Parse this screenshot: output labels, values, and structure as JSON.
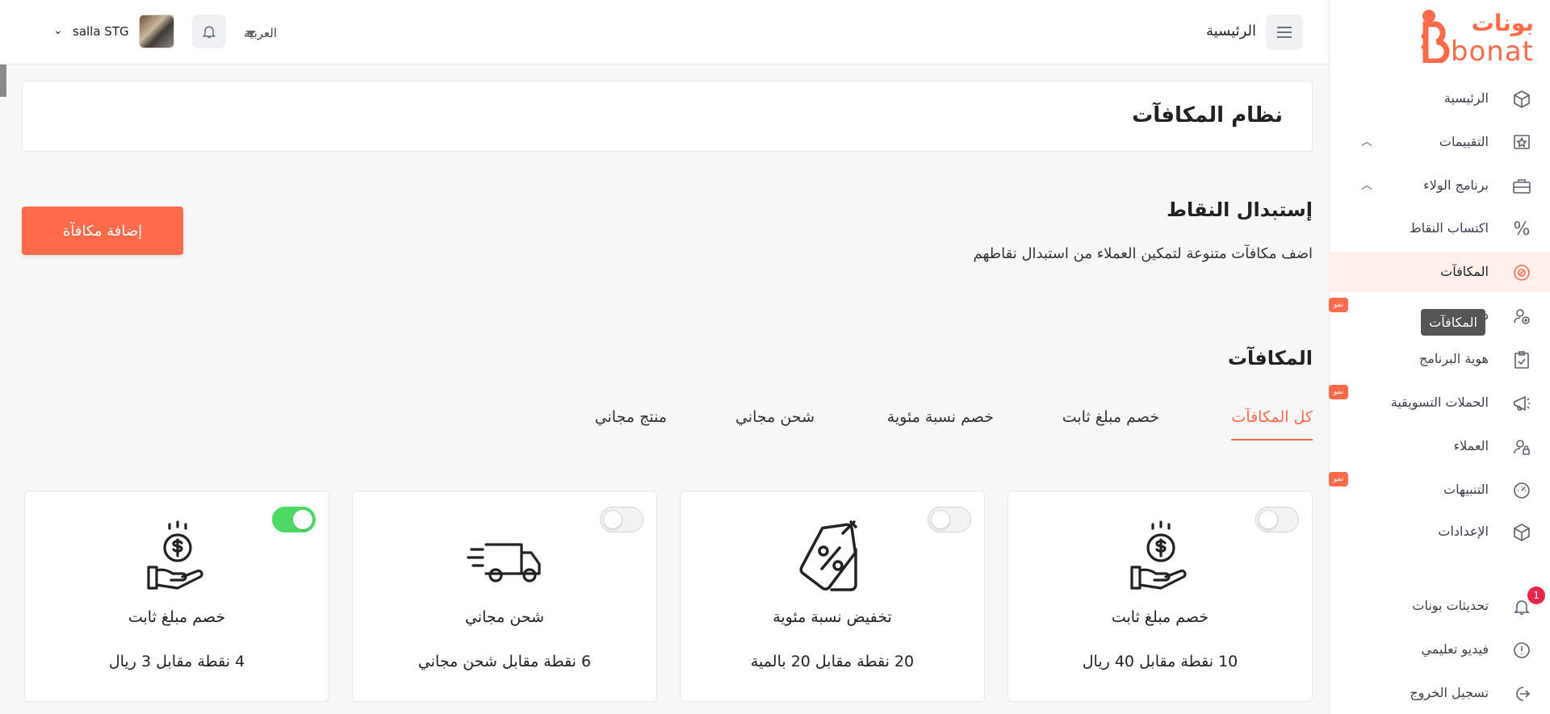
{
  "colors": {
    "accent": "#ff6b4a",
    "toggle_on": "#4cd964",
    "active_bg": "#fff0ec",
    "badge_red": "#e8264a"
  },
  "brand": {
    "name_ar": "بونات",
    "name_en": "bonat"
  },
  "sidebar": {
    "items": [
      {
        "label": "الرئيسية",
        "icon": "cube-icon"
      },
      {
        "label": "التقييمات",
        "icon": "star-badge-icon",
        "chevron": "up"
      },
      {
        "label": "برنامج الولاء",
        "icon": "briefcase-icon",
        "chevron": "up"
      },
      {
        "label": "اكتساب النقاط",
        "icon": "percent-icon"
      },
      {
        "label": "المكافآت",
        "icon": "coin-icon",
        "active": true
      },
      {
        "label": "دع",
        "icon": "user-plus-icon",
        "badge": "نمو"
      },
      {
        "label": "هوية البرنامج",
        "icon": "clipboard-check-icon"
      },
      {
        "label": "الحملات التسويقية",
        "icon": "megaphone-icon",
        "badge": "نمو"
      },
      {
        "label": "العملاء",
        "icon": "user-lock-icon"
      },
      {
        "label": "التنبيهات",
        "icon": "gauge-icon",
        "badge": "نمو"
      },
      {
        "label": "الإعدادات",
        "icon": "cube-icon"
      },
      {
        "label": "تحديثات بونات",
        "icon": "bell-icon",
        "count": "1"
      },
      {
        "label": "فيديو تعليمي",
        "icon": "info-circle-icon"
      },
      {
        "label": "تسجيل الخروج",
        "icon": "logout-icon"
      }
    ],
    "tooltip": "المكافآت"
  },
  "topbar": {
    "title": "الرئيسية",
    "language": "العربية",
    "store_name": "salla STG"
  },
  "page": {
    "title": "نظام المكافآت",
    "section_title": "إستبدال النقاط",
    "section_desc": "اضف مكافآت متنوعة لتمكين العملاء من استبدال نقاطهم",
    "add_button": "إضافة مكافآة",
    "rewards_title": "المكافآت"
  },
  "tabs": [
    {
      "label": "كل المكافآت",
      "active": true
    },
    {
      "label": "خصم مبلغ ثابت"
    },
    {
      "label": "خصم نسبة مئوية"
    },
    {
      "label": "شحن مجاني"
    },
    {
      "label": "منتج مجاني"
    }
  ],
  "cards": [
    {
      "name": "خصم مبلغ ثابت",
      "value": "10 نقطة مقابل 40 ريال",
      "icon": "hand-coin-icon",
      "enabled": false
    },
    {
      "name": "تخفيض نسبة مئوية",
      "value": "20 نقطة مقابل 20 بالمية",
      "icon": "percent-tag-icon",
      "enabled": false
    },
    {
      "name": "شحن مجاني",
      "value": "6 نقطة مقابل شحن مجاني",
      "icon": "delivery-truck-icon",
      "enabled": false
    },
    {
      "name": "خصم مبلغ ثابت",
      "value": "4 نقطة مقابل 3 ريال",
      "icon": "hand-coin-icon",
      "enabled": true
    }
  ]
}
